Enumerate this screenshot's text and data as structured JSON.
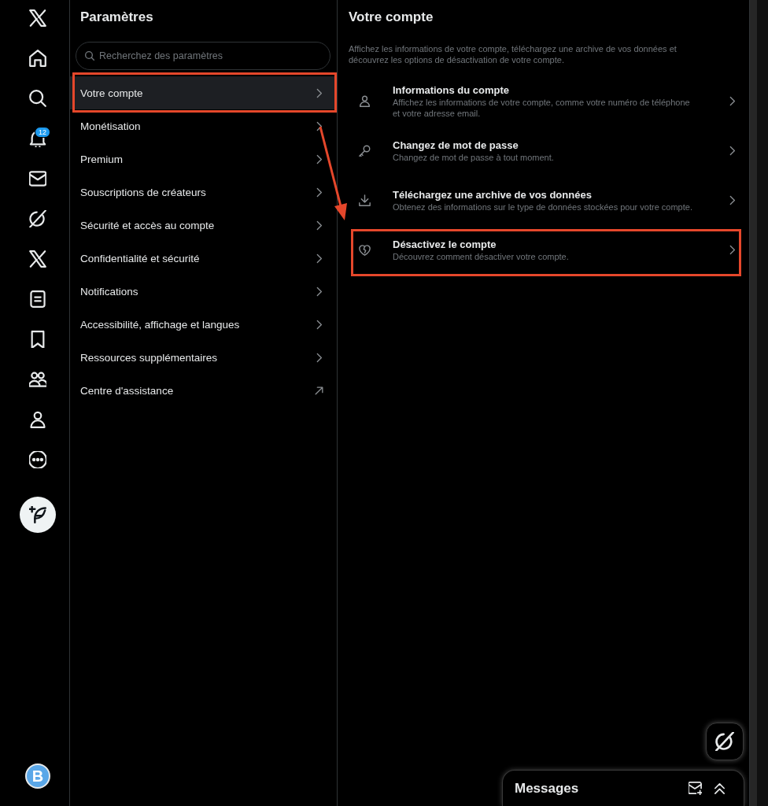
{
  "nav_rail": {
    "notifications_badge": "12",
    "avatar_letter": "B"
  },
  "settings": {
    "title": "Paramètres",
    "search": {
      "placeholder": "Recherchez des paramètres"
    },
    "items": [
      {
        "label": "Votre compte",
        "kind": "chevron",
        "selected": true,
        "highlighted": true
      },
      {
        "label": "Monétisation",
        "kind": "chevron",
        "selected": false,
        "highlighted": false
      },
      {
        "label": "Premium",
        "kind": "chevron",
        "selected": false,
        "highlighted": false
      },
      {
        "label": "Souscriptions de créateurs",
        "kind": "chevron",
        "selected": false,
        "highlighted": false
      },
      {
        "label": "Sécurité et accès au compte",
        "kind": "chevron",
        "selected": false,
        "highlighted": false
      },
      {
        "label": "Confidentialité et sécurité",
        "kind": "chevron",
        "selected": false,
        "highlighted": false
      },
      {
        "label": "Notifications",
        "kind": "chevron",
        "selected": false,
        "highlighted": false
      },
      {
        "label": "Accessibilité, affichage et langues",
        "kind": "chevron",
        "selected": false,
        "highlighted": false
      },
      {
        "label": "Ressources supplémentaires",
        "kind": "chevron",
        "selected": false,
        "highlighted": false
      },
      {
        "label": "Centre d'assistance",
        "kind": "external",
        "selected": false,
        "highlighted": false
      }
    ]
  },
  "account": {
    "title": "Votre compte",
    "description": "Affichez les informations de votre compte, téléchargez une archive de vos données et découvrez les options de désactivation de votre compte.",
    "items": [
      {
        "title": "Informations du compte",
        "description": "Affichez les informations de votre compte, comme votre numéro de téléphone et votre adresse email.",
        "highlighted": false
      },
      {
        "title": "Changez de mot de passe",
        "description": "Changez de mot de passe à tout moment.",
        "highlighted": false
      },
      {
        "title": "Téléchargez une archive de vos données",
        "description": "Obtenez des informations sur le type de données stockées pour votre compte.",
        "highlighted": false
      },
      {
        "title": "Désactivez le compte",
        "description": "Découvrez comment désactiver votre compte.",
        "highlighted": true
      }
    ]
  },
  "messages_drawer": {
    "title": "Messages"
  }
}
